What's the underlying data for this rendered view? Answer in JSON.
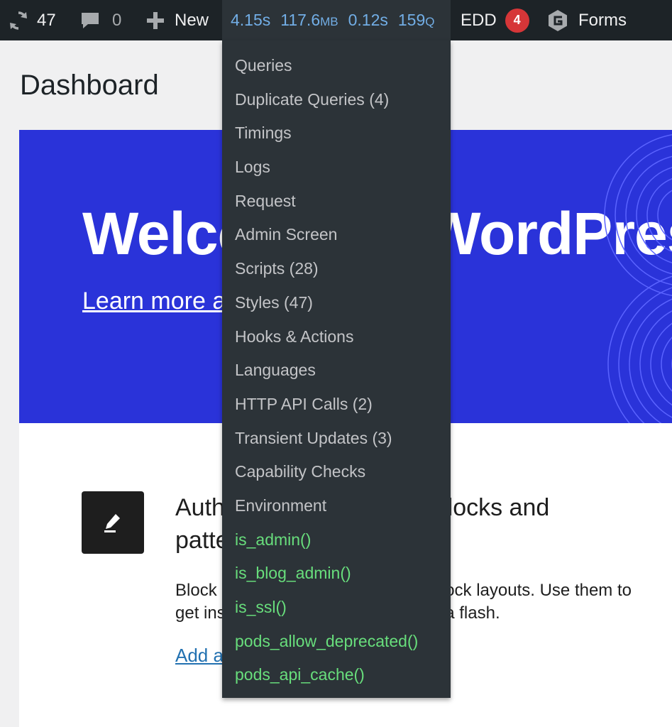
{
  "adminbar": {
    "updates_count": "47",
    "comments_count": "0",
    "new_label": "New",
    "qm": {
      "time": "4.15s",
      "memory_value": "117.6",
      "memory_unit": "MB",
      "db_time": "0.12s",
      "queries_value": "159",
      "queries_unit": "Q"
    },
    "edd_label": "EDD",
    "edd_badge": "4",
    "forms_label": "Forms"
  },
  "page": {
    "title": "Dashboard"
  },
  "welcome": {
    "heading": "Welcome to WordPress",
    "link": "Learn more about the 6.x version."
  },
  "panel": {
    "heading": "Author rich content with blocks and patterns",
    "text": "Block patterns are pre-configured block layouts. Use them to get inspired or create new pages in a flash.",
    "link": "Add a new page"
  },
  "dropdown": {
    "items": [
      "Queries",
      "Duplicate Queries (4)",
      "Timings",
      "Logs",
      "Request",
      "Admin Screen",
      "Scripts (28)",
      "Styles (47)",
      "Hooks & Actions",
      "Languages",
      "HTTP API Calls (2)",
      "Transient Updates (3)",
      "Capability Checks",
      "Environment"
    ],
    "conditionals": [
      "is_admin()",
      "is_blog_admin()",
      "is_ssl()",
      "pods_allow_deprecated()",
      "pods_api_cache()"
    ]
  },
  "colors": {
    "adminbar_bg": "#1d2327",
    "qm_text": "#72aee6",
    "welcome_bg": "#2a33d9",
    "conditional_green": "#68de7c",
    "badge_red": "#d63638"
  },
  "icons": [
    "updates-icon",
    "comment-icon",
    "plus-icon",
    "gravity-forms-icon",
    "pencil-icon"
  ]
}
